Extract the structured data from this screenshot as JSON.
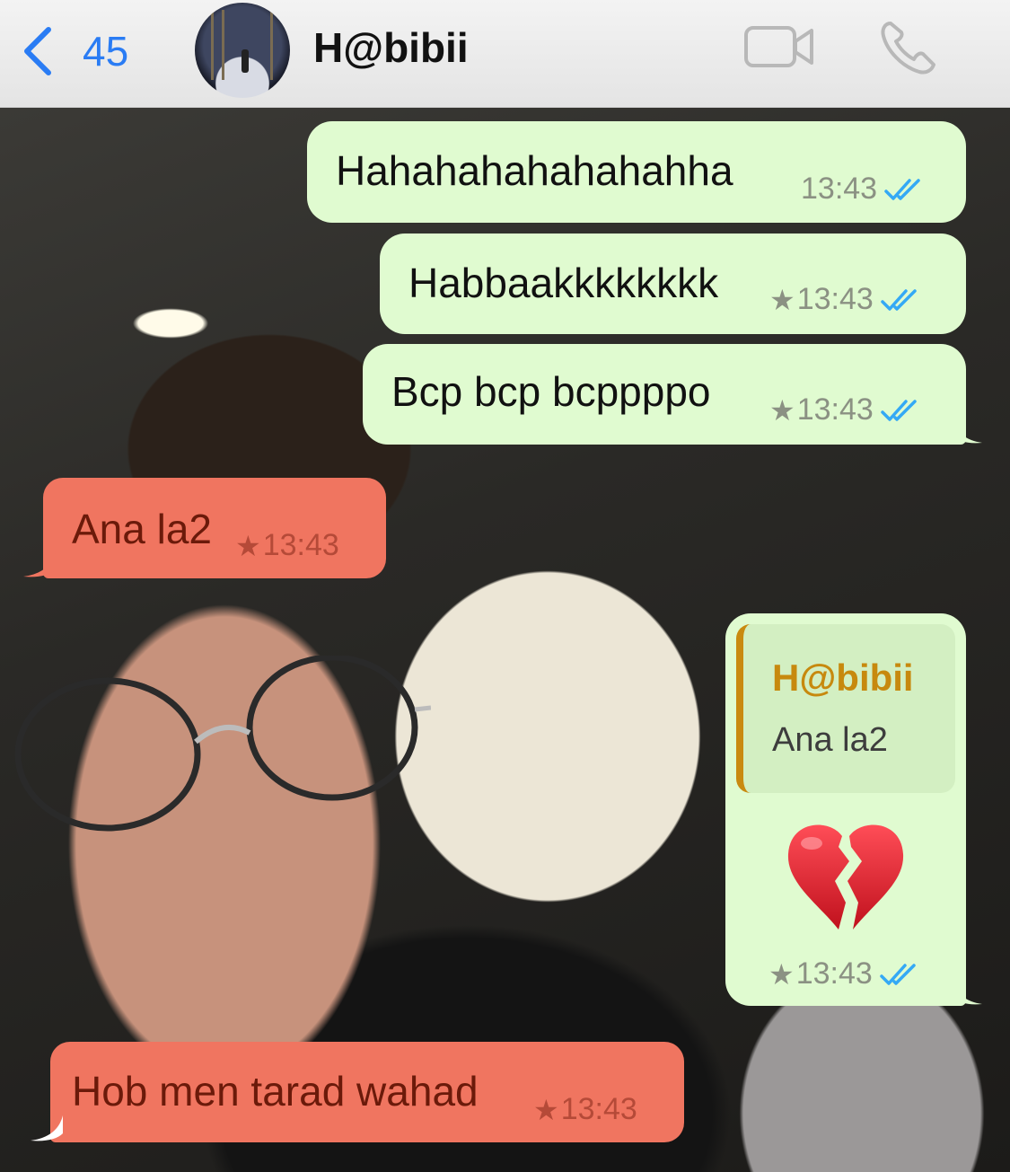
{
  "header": {
    "back_count": "45",
    "contact_name": "H@bibii",
    "accent_color": "#2a7cf4"
  },
  "messages": [
    {
      "direction": "outgoing",
      "text": "Hahahahahahahahha",
      "time": "13:43",
      "starred": false,
      "status": "read"
    },
    {
      "direction": "outgoing",
      "text": "Habbaakkkkkkkk",
      "time": "13:43",
      "starred": true,
      "status": "read"
    },
    {
      "direction": "outgoing",
      "text": "Bcp bcp bcppppo",
      "time": "13:43",
      "starred": true,
      "status": "read"
    },
    {
      "direction": "incoming",
      "text": "Ana la2",
      "time": "13:43",
      "starred": true
    },
    {
      "direction": "outgoing",
      "reply_to": {
        "name": "H@bibii",
        "text": "Ana la2"
      },
      "emoji": "broken-heart",
      "time": "13:43",
      "starred": true,
      "status": "read"
    },
    {
      "direction": "incoming",
      "text": "Hob men tarad wahad",
      "time": "13:43",
      "starred": true
    }
  ],
  "icons": {
    "back": "chevron-left-icon",
    "video": "video-camera-icon",
    "call": "phone-icon",
    "star": "star-icon",
    "read_receipt": "double-check-icon",
    "emoji": "broken-heart-icon"
  },
  "colors": {
    "outgoing_bubble": "#e0fbd0",
    "incoming_bubble": "#f07560",
    "read_check": "#34a9f5",
    "quote_bar": "#c98a10"
  }
}
